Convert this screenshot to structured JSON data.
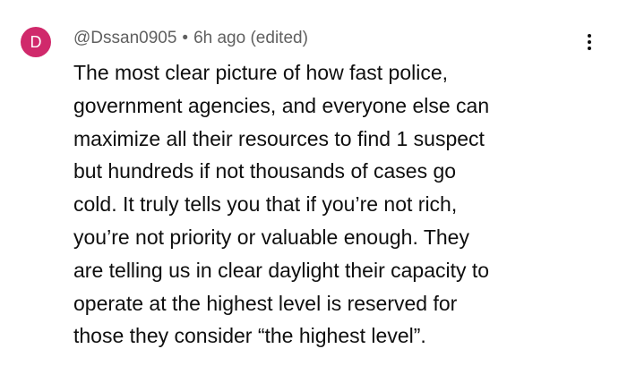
{
  "comment": {
    "avatar_letter": "D",
    "avatar_color": "#d0296b",
    "author": "@Dssan0905",
    "separator": "•",
    "time": "6h ago",
    "edited": "(edited)",
    "menu_icon": "more-vertical-icon",
    "body_lines": [
      "The most clear picture of how fast police,",
      "government agencies, and everyone else can",
      "maximize all their resources to find 1 suspect",
      "but hundreds if not thousands of cases go",
      "cold. It truly tells you that if you’re not rich,",
      "you’re not priority or valuable enough. They",
      "are telling us in clear daylight their capacity to",
      "operate at the highest level is reserved for",
      "those they consider  “the highest level”."
    ]
  }
}
